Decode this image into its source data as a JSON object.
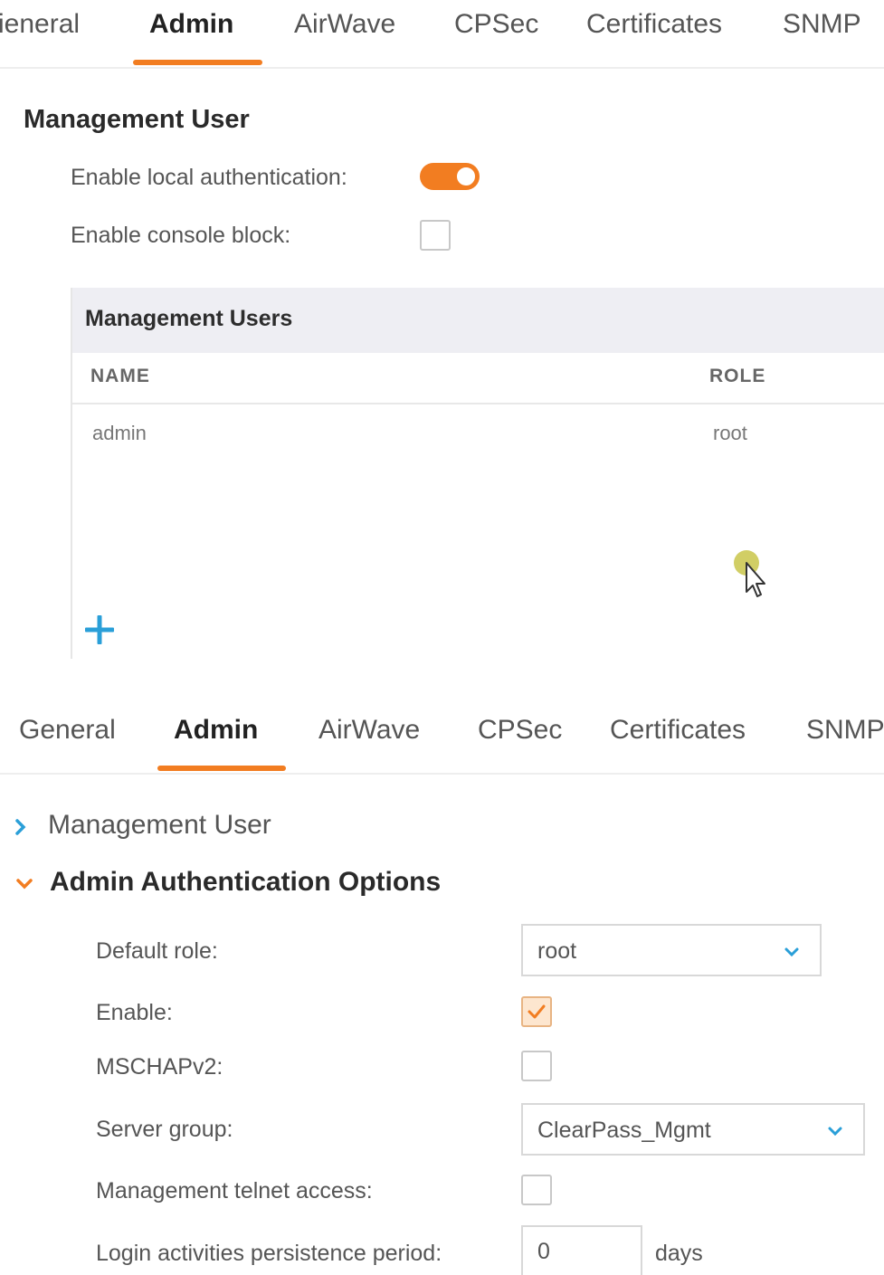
{
  "top_tabs": {
    "items": [
      "ieneral",
      "Admin",
      "AirWave",
      "CPSec",
      "Certificates",
      "SNMP"
    ],
    "active": "Admin"
  },
  "management_user": {
    "title": "Management User",
    "local_auth_label": "Enable local authentication:",
    "local_auth_on": true,
    "console_block_label": "Enable console block:",
    "console_block_checked": false,
    "table": {
      "title": "Management Users",
      "columns": [
        "NAME",
        "ROLE"
      ],
      "rows": [
        {
          "name": "admin",
          "role": "root"
        }
      ]
    }
  },
  "bottom_tabs": {
    "items": [
      "General",
      "Admin",
      "AirWave",
      "CPSec",
      "Certificates",
      "SNMP"
    ],
    "active": "Admin"
  },
  "accordion": {
    "management_user_label": "Management User",
    "admin_auth_label": "Admin Authentication Options"
  },
  "admin_auth": {
    "default_role_label": "Default role:",
    "default_role_value": "root",
    "enable_label": "Enable:",
    "enable_checked": true,
    "mschap_label": "MSCHAPv2:",
    "mschap_checked": false,
    "server_group_label": "Server group:",
    "server_group_value": "ClearPass_Mgmt",
    "telnet_label": "Management telnet access:",
    "telnet_checked": false,
    "persistence_label": "Login activities persistence period:",
    "persistence_value": "0",
    "persistence_unit": "days"
  },
  "colors": {
    "accent": "#f27d21",
    "link_blue": "#2a9fd8",
    "table_header_bg": "#eeeef3"
  }
}
